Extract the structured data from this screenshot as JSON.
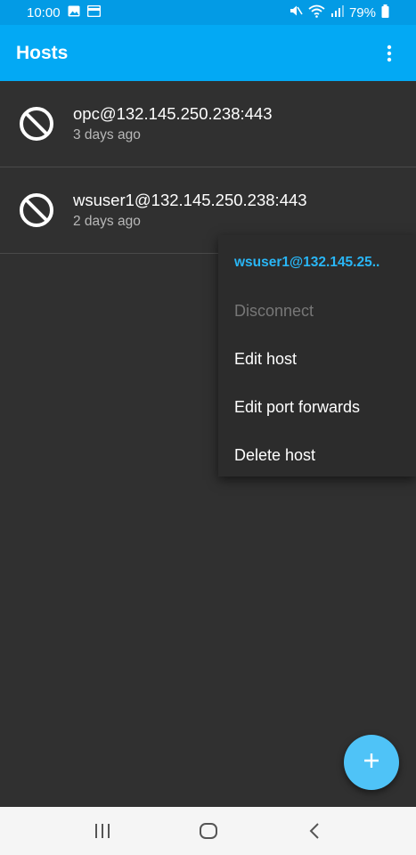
{
  "status_bar": {
    "time": "10:00",
    "battery": "79%",
    "icons": [
      "image-icon",
      "card-icon",
      "mute-icon",
      "wifi-icon",
      "signal-icon",
      "battery-icon"
    ]
  },
  "app_bar": {
    "title": "Hosts",
    "menu_icon": "more-vert-icon"
  },
  "hosts": [
    {
      "name": "opc@132.145.250.238:443",
      "last_connected": "3 days ago",
      "status_icon": "disconnected-icon"
    },
    {
      "name": "wsuser1@132.145.250.238:443",
      "last_connected": "2 days ago",
      "status_icon": "disconnected-icon"
    }
  ],
  "context_menu": {
    "header": "wsuser1@132.145.25..",
    "items": [
      {
        "label": "Disconnect",
        "enabled": false
      },
      {
        "label": "Edit host",
        "enabled": true
      },
      {
        "label": "Edit port forwards",
        "enabled": true
      },
      {
        "label": "Delete host",
        "enabled": true
      }
    ]
  },
  "fab": {
    "icon": "add-icon"
  },
  "nav_bar": {
    "buttons": [
      "recents-icon",
      "home-icon",
      "back-icon"
    ]
  },
  "colors": {
    "app_bar": "#03a9f4",
    "status_bar": "#039be5",
    "background": "#303030",
    "accent": "#29b6f6",
    "fab": "#4fc3f7"
  }
}
